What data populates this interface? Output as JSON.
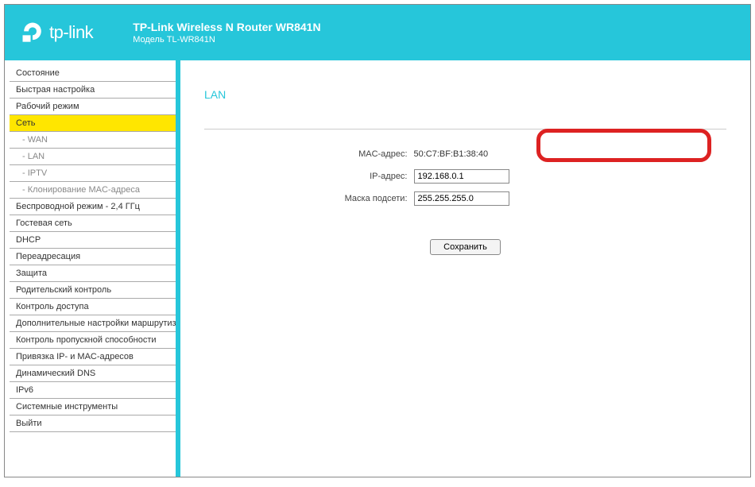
{
  "header": {
    "brand": "tp-link",
    "title": "TP-Link Wireless N Router WR841N",
    "subtitle": "Модель TL-WR841N"
  },
  "sidebar": {
    "items": [
      {
        "label": "Состояние",
        "sub": false,
        "selected": false
      },
      {
        "label": "Быстрая настройка",
        "sub": false,
        "selected": false
      },
      {
        "label": "Рабочий режим",
        "sub": false,
        "selected": false
      },
      {
        "label": "Сеть",
        "sub": false,
        "selected": true
      },
      {
        "label": "- WAN",
        "sub": true,
        "selected": false
      },
      {
        "label": "- LAN",
        "sub": true,
        "selected": false
      },
      {
        "label": "- IPTV",
        "sub": true,
        "selected": false
      },
      {
        "label": "- Клонирование MAC-адреса",
        "sub": true,
        "selected": false
      },
      {
        "label": "Беспроводной режим - 2,4 ГГц",
        "sub": false,
        "selected": false
      },
      {
        "label": "Гостевая сеть",
        "sub": false,
        "selected": false
      },
      {
        "label": "DHCP",
        "sub": false,
        "selected": false
      },
      {
        "label": "Переадресация",
        "sub": false,
        "selected": false
      },
      {
        "label": "Защита",
        "sub": false,
        "selected": false
      },
      {
        "label": "Родительский контроль",
        "sub": false,
        "selected": false
      },
      {
        "label": "Контроль доступа",
        "sub": false,
        "selected": false
      },
      {
        "label": "Дополнительные настройки маршрутизации",
        "sub": false,
        "selected": false
      },
      {
        "label": "Контроль пропускной способности",
        "sub": false,
        "selected": false
      },
      {
        "label": "Привязка IP- и MAC-адресов",
        "sub": false,
        "selected": false
      },
      {
        "label": "Динамический DNS",
        "sub": false,
        "selected": false
      },
      {
        "label": "IPv6",
        "sub": false,
        "selected": false
      },
      {
        "label": "Системные инструменты",
        "sub": false,
        "selected": false
      },
      {
        "label": "Выйти",
        "sub": false,
        "selected": false
      }
    ]
  },
  "content": {
    "page_title": "LAN",
    "mac_label": "MAC-адрес:",
    "mac_value": "50:C7:BF:B1:38:40",
    "ip_label": "IP-адрес:",
    "ip_value": "192.168.0.1",
    "mask_label": "Маска подсети:",
    "mask_value": "255.255.255.0",
    "save_label": "Сохранить"
  }
}
